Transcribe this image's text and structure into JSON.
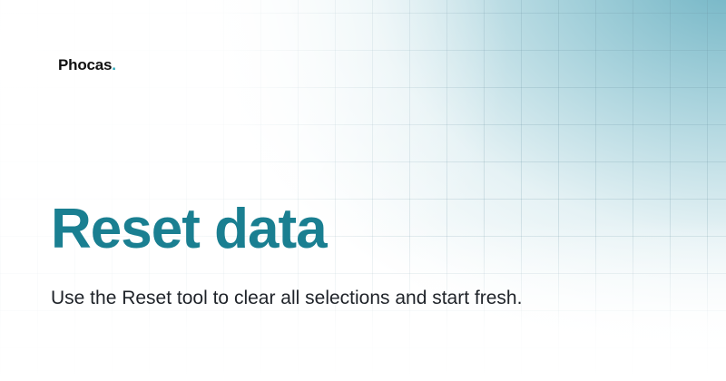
{
  "brand": {
    "name": "Phocas",
    "dot": ".",
    "accent_color": "#2aa6b8"
  },
  "hero": {
    "title": "Reset data",
    "subtitle": "Use the Reset tool to clear all selections and start fresh.",
    "title_color": "#1a7f91",
    "text_color": "#1f2329"
  },
  "background": {
    "gradient_color": "#62acbe",
    "grid": true
  }
}
